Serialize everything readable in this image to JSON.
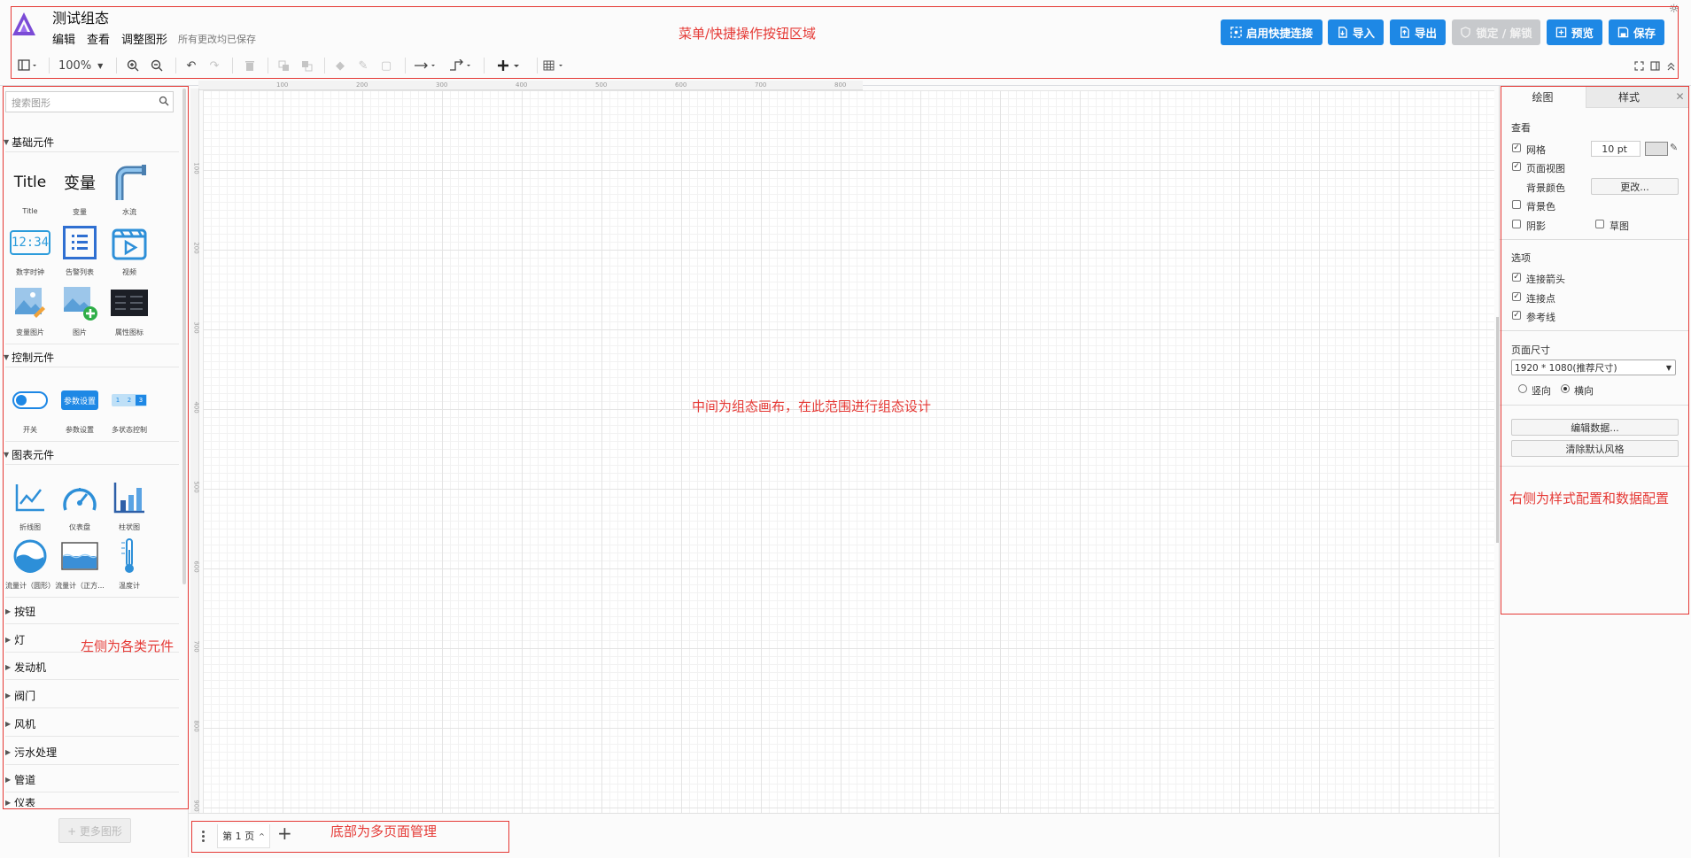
{
  "header": {
    "title": "测试组态",
    "menus": [
      "编辑",
      "查看",
      "调整图形"
    ],
    "save_status": "所有更改均已保存",
    "buttons": {
      "quick_connect": "启用快捷连接",
      "import": "导入",
      "export": "导出",
      "lock": "锁定 / 解锁",
      "preview": "预览",
      "save": "保存"
    },
    "accent_color": "#1e88e5"
  },
  "toolbar": {
    "zoom": "100%",
    "icons": [
      "sidebar-toggle-icon",
      "zoom-in-icon",
      "zoom-out-icon",
      "undo-icon",
      "redo-icon",
      "delete-icon",
      "to-front-icon",
      "to-back-icon",
      "fill-color-icon",
      "line-color-icon",
      "shadow-icon",
      "connection-icon",
      "waypoints-icon",
      "insert-icon",
      "table-icon",
      "fullscreen-icon",
      "format-panel-icon",
      "collapse-icon"
    ]
  },
  "sidebar": {
    "search_placeholder": "搜索图形",
    "sections": {
      "basic": {
        "title": "基础元件",
        "items": [
          {
            "label": "Title",
            "icon_text": "Title"
          },
          {
            "label": "变量",
            "icon_text": "变量"
          },
          {
            "label": "水流"
          },
          {
            "label": "数字时钟",
            "icon_text": "12:34"
          },
          {
            "label": "告警列表"
          },
          {
            "label": "视频"
          },
          {
            "label": "变量图片"
          },
          {
            "label": "图片"
          },
          {
            "label": "属性图标"
          }
        ]
      },
      "control": {
        "title": "控制元件",
        "items": [
          {
            "label": "开关"
          },
          {
            "label": "参数设置",
            "icon_text": "参数设置"
          },
          {
            "label": "多状态控制",
            "icon_text": [
              "1",
              "2",
              "3"
            ]
          }
        ]
      },
      "chart": {
        "title": "图表元件",
        "items": [
          {
            "label": "折线图"
          },
          {
            "label": "仪表盘"
          },
          {
            "label": "柱状图"
          },
          {
            "label": "流量计（圆形）"
          },
          {
            "label": "流量计（正方..."
          },
          {
            "label": "温度计"
          }
        ]
      }
    },
    "categories": [
      "按钮",
      "灯",
      "发动机",
      "阀门",
      "风机",
      "污水处理",
      "管道",
      "仪表"
    ],
    "more_shapes": "+ 更多图形"
  },
  "canvas": {
    "ruler_top": [
      "100",
      "200",
      "300",
      "400",
      "500",
      "600",
      "700",
      "800"
    ],
    "ruler_left": [
      "100",
      "200",
      "300",
      "400",
      "500",
      "600",
      "700",
      "800",
      "900"
    ]
  },
  "annotations": {
    "menu_area": "菜单/快捷操作按钮区域",
    "canvas_area": "中间为组态画布，在此范围进行组态设计",
    "left_area": "左侧为各类元件",
    "right_area": "右侧为样式配置和数据配置",
    "bottom_area": "底部为多页面管理"
  },
  "pages": {
    "current": "第 1 页"
  },
  "format_panel": {
    "tabs": [
      "绘图",
      "样式"
    ],
    "view": {
      "title": "查看",
      "grid": {
        "label": "网格",
        "checked": true,
        "size": "10 pt"
      },
      "page_view": {
        "label": "页面视图",
        "checked": true
      },
      "background_color_label": "背景颜色",
      "change_button": "更改...",
      "background": {
        "label": "背景色",
        "checked": false
      },
      "shadow": {
        "label": "阴影",
        "checked": false
      },
      "sketch": {
        "label": "草图",
        "checked": false
      }
    },
    "options": {
      "title": "选项",
      "connection_arrows": {
        "label": "连接箭头",
        "checked": true
      },
      "connection_points": {
        "label": "连接点",
        "checked": true
      },
      "guides": {
        "label": "参考线",
        "checked": true
      }
    },
    "page_size": {
      "title": "页面尺寸",
      "value": "1920 * 1080(推荐尺寸)",
      "portrait": "竖向",
      "landscape": "横向",
      "orientation": "landscape"
    },
    "edit_data_button": "编辑数据...",
    "clear_style_button": "清除默认风格"
  }
}
